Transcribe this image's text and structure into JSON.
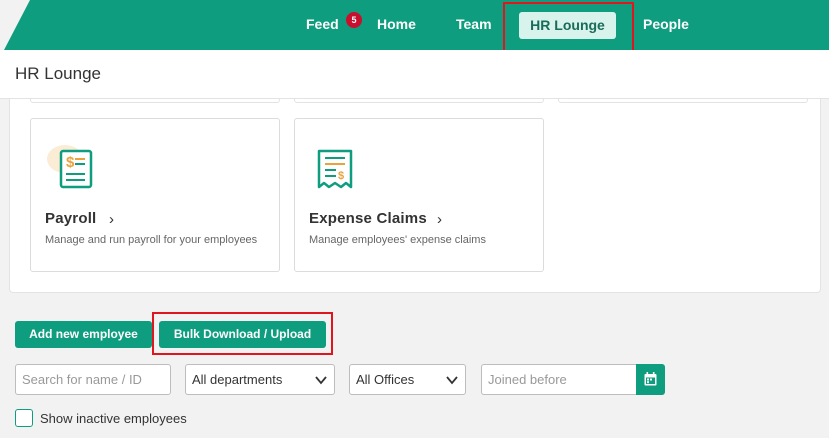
{
  "nav": {
    "feed_label": "Feed",
    "feed_badge": "5",
    "home_label": "Home",
    "team_label": "Team",
    "hr_lounge_label": "HR Lounge",
    "people_label": "People"
  },
  "page": {
    "title": "HR Lounge"
  },
  "cards": [
    {
      "title": "Payroll",
      "description": "Manage and run payroll for your employees",
      "icon": "payroll-icon"
    },
    {
      "title": "Expense Claims",
      "description": "Manage employees' expense claims",
      "icon": "receipt-icon"
    }
  ],
  "actions": {
    "add_employee_label": "Add new employee",
    "bulk_label": "Bulk Download / Upload"
  },
  "filters": {
    "search_placeholder": "Search for name / ID",
    "department_value": "All departments",
    "office_value": "All Offices",
    "joined_placeholder": "Joined before"
  },
  "inactive": {
    "label": "Show inactive employees",
    "checked": false
  },
  "colors": {
    "brand": "#0f9d80",
    "badge": "#c8102e",
    "highlight": "#e0161e",
    "icon_accent": "#e8a33c"
  }
}
